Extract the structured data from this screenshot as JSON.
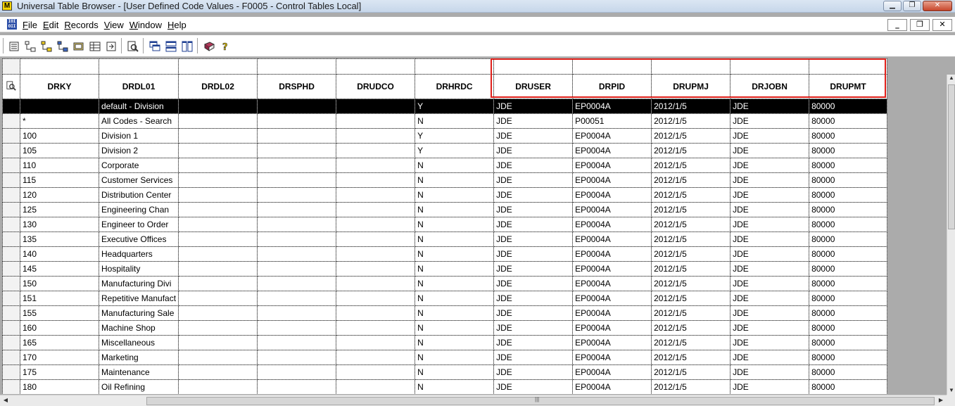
{
  "window": {
    "title": "Universal Table Browser - [User Defined Code Values - F0005 - Control Tables Local]",
    "app_icon_letter": "M"
  },
  "menu": [
    "File",
    "Edit",
    "Records",
    "View",
    "Window",
    "Help"
  ],
  "toolbar_icons": [
    "grid-view-icon",
    "tree-icon",
    "tree-yellow-icon",
    "tree-blue-icon",
    "properties-icon",
    "table-icon",
    "export-icon",
    "find-icon",
    "cascade-icon",
    "tile-horizontal-icon",
    "tile-vertical-icon",
    "book-icon",
    "help-icon"
  ],
  "columns": [
    "DRKY",
    "DRDL01",
    "DRDL02",
    "DRSPHD",
    "DRUDCO",
    "DRHRDC",
    "DRUSER",
    "DRPID",
    "DRUPMJ",
    "DRJOBN",
    "DRUPMT"
  ],
  "rows": [
    [
      "",
      "default - Division",
      "",
      "",
      "",
      "Y",
      "JDE",
      "EP0004A",
      "2012/1/5",
      "JDE",
      "80000"
    ],
    [
      "*",
      "All Codes - Search",
      "",
      "",
      "",
      "N",
      "JDE",
      "P00051",
      "2012/1/5",
      "JDE",
      "80000"
    ],
    [
      "100",
      "Division 1",
      "",
      "",
      "",
      "Y",
      "JDE",
      "EP0004A",
      "2012/1/5",
      "JDE",
      "80000"
    ],
    [
      "105",
      "Division 2",
      "",
      "",
      "",
      "Y",
      "JDE",
      "EP0004A",
      "2012/1/5",
      "JDE",
      "80000"
    ],
    [
      "110",
      "Corporate",
      "",
      "",
      "",
      "N",
      "JDE",
      "EP0004A",
      "2012/1/5",
      "JDE",
      "80000"
    ],
    [
      "115",
      "Customer Services",
      "",
      "",
      "",
      "N",
      "JDE",
      "EP0004A",
      "2012/1/5",
      "JDE",
      "80000"
    ],
    [
      "120",
      "Distribution Center",
      "",
      "",
      "",
      "N",
      "JDE",
      "EP0004A",
      "2012/1/5",
      "JDE",
      "80000"
    ],
    [
      "125",
      "Engineering Chan",
      "",
      "",
      "",
      "N",
      "JDE",
      "EP0004A",
      "2012/1/5",
      "JDE",
      "80000"
    ],
    [
      "130",
      "Engineer to Order",
      "",
      "",
      "",
      "N",
      "JDE",
      "EP0004A",
      "2012/1/5",
      "JDE",
      "80000"
    ],
    [
      "135",
      "Executive Offices",
      "",
      "",
      "",
      "N",
      "JDE",
      "EP0004A",
      "2012/1/5",
      "JDE",
      "80000"
    ],
    [
      "140",
      "Headquarters",
      "",
      "",
      "",
      "N",
      "JDE",
      "EP0004A",
      "2012/1/5",
      "JDE",
      "80000"
    ],
    [
      "145",
      "Hospitality",
      "",
      "",
      "",
      "N",
      "JDE",
      "EP0004A",
      "2012/1/5",
      "JDE",
      "80000"
    ],
    [
      "150",
      "Manufacturing Divi",
      "",
      "",
      "",
      "N",
      "JDE",
      "EP0004A",
      "2012/1/5",
      "JDE",
      "80000"
    ],
    [
      "151",
      "Repetitive Manufact",
      "",
      "",
      "",
      "N",
      "JDE",
      "EP0004A",
      "2012/1/5",
      "JDE",
      "80000"
    ],
    [
      "155",
      "Manufacturing Sale",
      "",
      "",
      "",
      "N",
      "JDE",
      "EP0004A",
      "2012/1/5",
      "JDE",
      "80000"
    ],
    [
      "160",
      "Machine Shop",
      "",
      "",
      "",
      "N",
      "JDE",
      "EP0004A",
      "2012/1/5",
      "JDE",
      "80000"
    ],
    [
      "165",
      "Miscellaneous",
      "",
      "",
      "",
      "N",
      "JDE",
      "EP0004A",
      "2012/1/5",
      "JDE",
      "80000"
    ],
    [
      "170",
      "Marketing",
      "",
      "",
      "",
      "N",
      "JDE",
      "EP0004A",
      "2012/1/5",
      "JDE",
      "80000"
    ],
    [
      "175",
      "Maintenance",
      "",
      "",
      "",
      "N",
      "JDE",
      "EP0004A",
      "2012/1/5",
      "JDE",
      "80000"
    ],
    [
      "180",
      "Oil Refining",
      "",
      "",
      "",
      "N",
      "JDE",
      "EP0004A",
      "2012/1/5",
      "JDE",
      "80000"
    ]
  ],
  "selected_row_index": 0,
  "highlight_color": "#e0201a"
}
